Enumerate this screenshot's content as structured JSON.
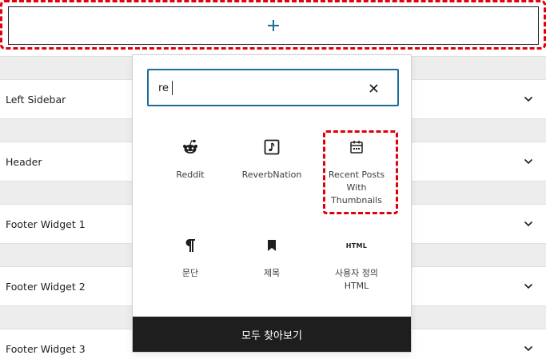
{
  "inserter": {
    "add_icon": "plus-icon",
    "accent": "#1a6e98",
    "highlight_color": "#e0000b"
  },
  "widget_areas": [
    {
      "title": "Left Sidebar",
      "icon": "chevron-down-icon"
    },
    {
      "title": "Header",
      "icon": "chevron-down-icon"
    },
    {
      "title": "Footer Widget 1",
      "icon": "chevron-down-icon"
    },
    {
      "title": "Footer Widget 2",
      "icon": "chevron-down-icon"
    },
    {
      "title": "Footer Widget 3",
      "icon": "chevron-down-icon"
    }
  ],
  "popover": {
    "search": {
      "value": "re",
      "clear_icon": "close-icon"
    },
    "blocks": [
      {
        "label": "Reddit",
        "icon": "reddit-icon"
      },
      {
        "label": "ReverbNation",
        "icon": "reverbnation-icon"
      },
      {
        "label": "Recent Posts With Thumbnails",
        "icon": "calendar-icon"
      },
      {
        "label": "문단",
        "icon": "paragraph-icon"
      },
      {
        "label": "제목",
        "icon": "bookmark-icon"
      },
      {
        "label": "사용자 정의 HTML",
        "icon": "html-icon",
        "icon_text": "HTML"
      }
    ],
    "browse_all_label": "모두 찾아보기"
  }
}
